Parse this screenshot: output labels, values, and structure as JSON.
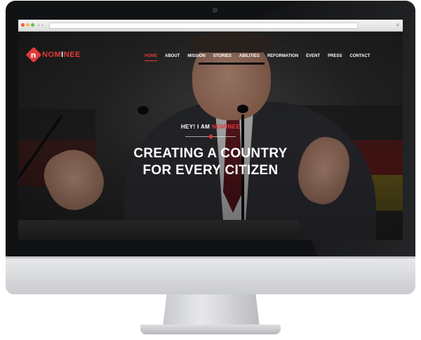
{
  "site": {
    "logo_mark": "n",
    "logo_parts": {
      "before": "NOM",
      "middle": "I",
      "after": "NEE"
    }
  },
  "nav": {
    "items": [
      {
        "label": "HOME",
        "active": true
      },
      {
        "label": "ABOUT",
        "active": false
      },
      {
        "label": "MISSION",
        "active": false
      },
      {
        "label": "STORIES",
        "active": false
      },
      {
        "label": "ABILITIES",
        "active": false
      },
      {
        "label": "REFORMATION",
        "active": false
      },
      {
        "label": "EVENT",
        "active": false
      },
      {
        "label": "PRESS",
        "active": false
      },
      {
        "label": "CONTACT",
        "active": false
      }
    ]
  },
  "hero": {
    "kicker_prefix": "HEY! I AM ",
    "kicker_accent": "NOMINEE",
    "title_line1": "CREATING A COUNTRY",
    "title_line2": "FOR EVERY CITIZEN"
  },
  "browser": {
    "nav_arrows": "‹ ›",
    "menu_glyph": "≡"
  },
  "colors": {
    "accent": "#e23a3a",
    "bezel": "#111214",
    "white": "#ffffff"
  }
}
